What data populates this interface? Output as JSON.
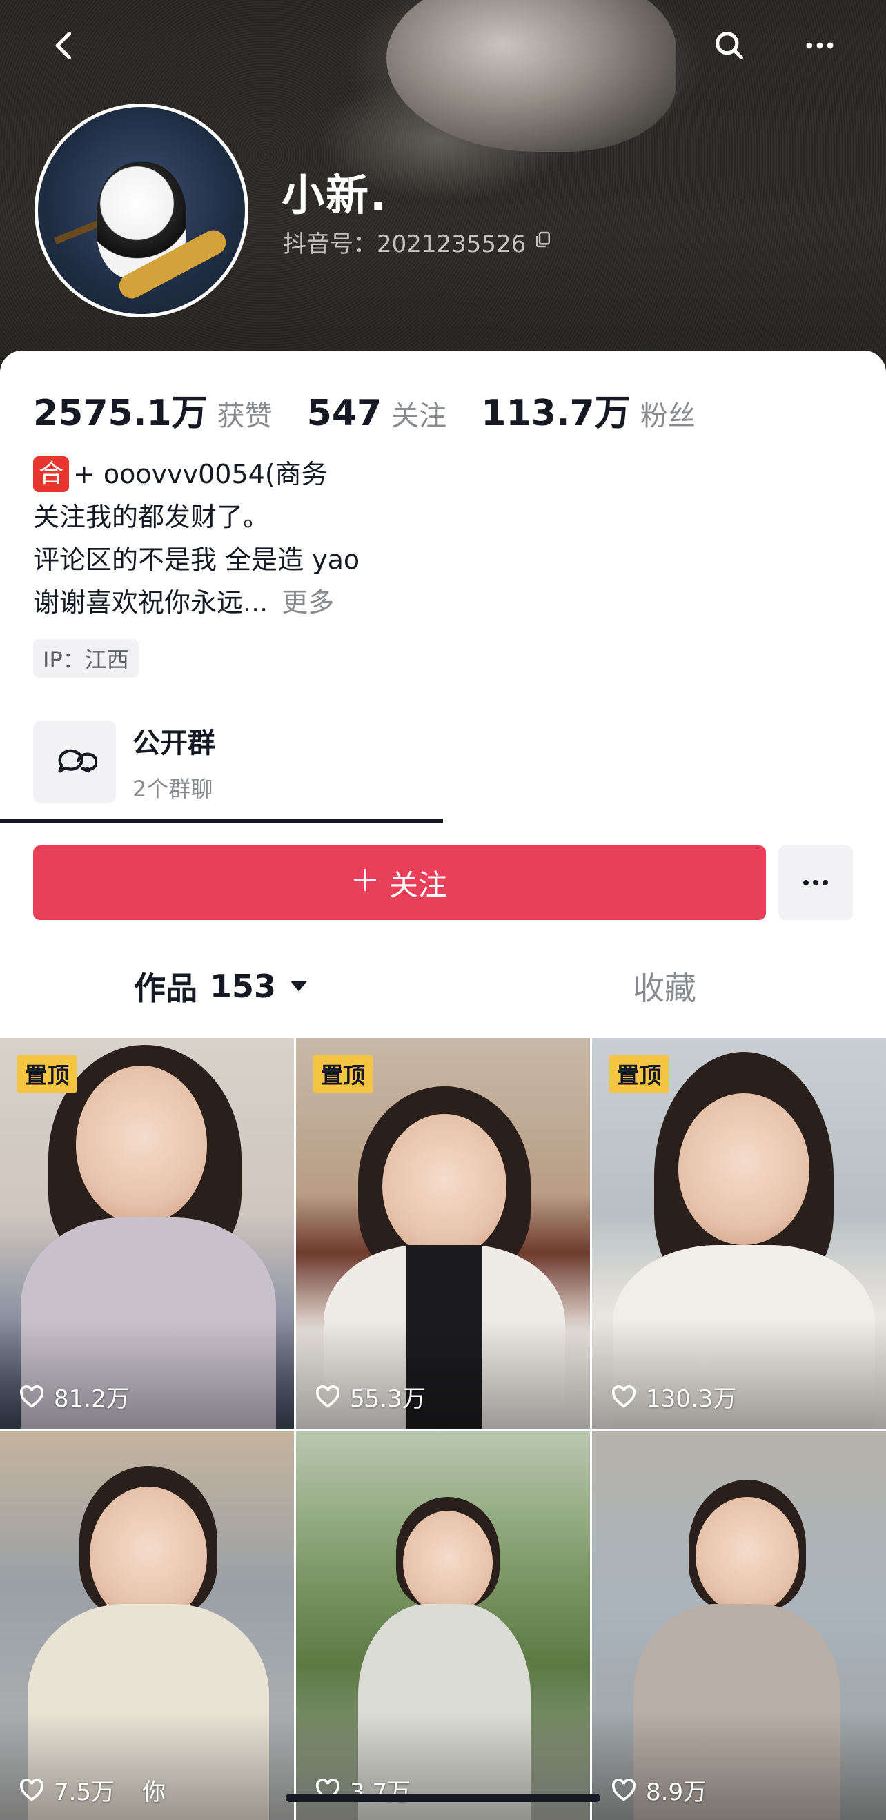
{
  "header": {
    "nickname": "小新.",
    "douyin_id": "抖音号：2021235526",
    "icons": [
      "back-icon",
      "search-icon",
      "more-icon",
      "copy-icon"
    ]
  },
  "stats": [
    {
      "value": "2575.1万",
      "label": "获赞"
    },
    {
      "value": "547",
      "label": "关注"
    },
    {
      "value": "113.7万",
      "label": "粉丝"
    }
  ],
  "bio": {
    "badge": "合",
    "line1": "+ ooovvv0054(商务",
    "line2": "关注我的都发财了。",
    "line3": "评论区的不是我 全是造 yao",
    "line4": "谢谢喜欢祝你永远...",
    "more": "更多"
  },
  "ip": "IP：江西",
  "group": {
    "title": "公开群",
    "subtitle": "2个群聊"
  },
  "actions": {
    "follow_label": "关注"
  },
  "tabs": {
    "works_label": "作品",
    "works_count": "153",
    "favorites_label": "收藏"
  },
  "videos": [
    {
      "pinned": true,
      "pin_label": "置顶",
      "likes": "81.2万",
      "extra": ""
    },
    {
      "pinned": true,
      "pin_label": "置顶",
      "likes": "55.3万",
      "extra": ""
    },
    {
      "pinned": true,
      "pin_label": "置顶",
      "likes": "130.3万",
      "extra": ""
    },
    {
      "pinned": false,
      "pin_label": "",
      "likes": "7.5万",
      "extra": "你"
    },
    {
      "pinned": false,
      "pin_label": "",
      "likes": "3.7万",
      "extra": ""
    },
    {
      "pinned": false,
      "pin_label": "",
      "likes": "8.9万",
      "extra": ""
    }
  ],
  "colors": {
    "accent": "#ea3f59",
    "pin_badge": "#f5c542",
    "text_primary": "#161823",
    "text_secondary": "#8a8b91"
  }
}
